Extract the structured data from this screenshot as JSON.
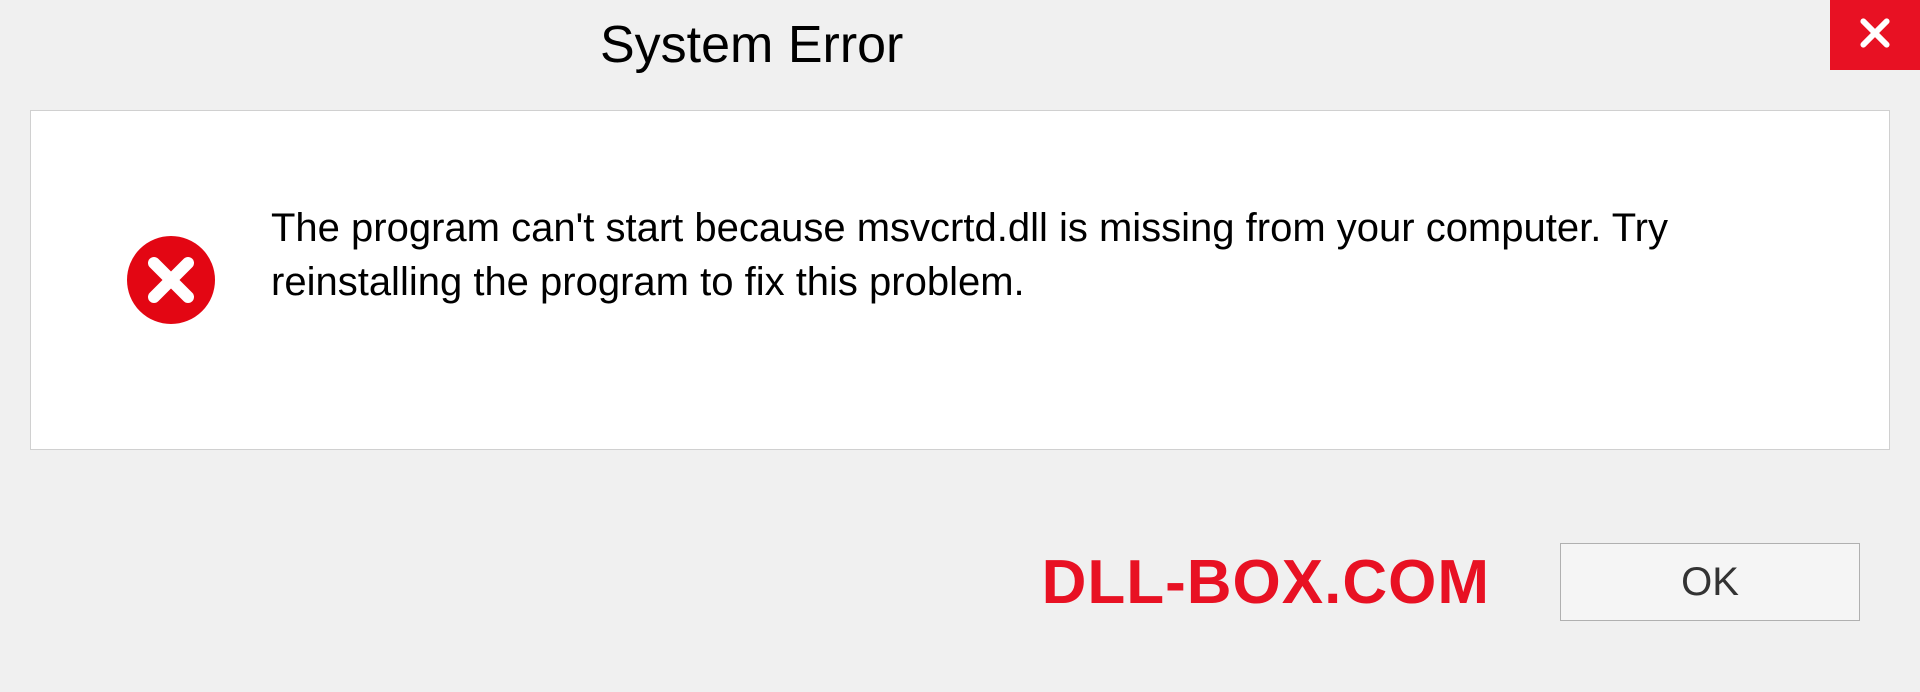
{
  "dialog": {
    "title": "System Error",
    "message": "The program can't start because msvcrtd.dll is missing from your computer. Try reinstalling the program to fix this problem.",
    "ok_label": "OK"
  },
  "watermark": "DLL-BOX.COM",
  "colors": {
    "close_bg": "#e81123",
    "error_icon": "#e30613",
    "watermark": "#e81123"
  }
}
